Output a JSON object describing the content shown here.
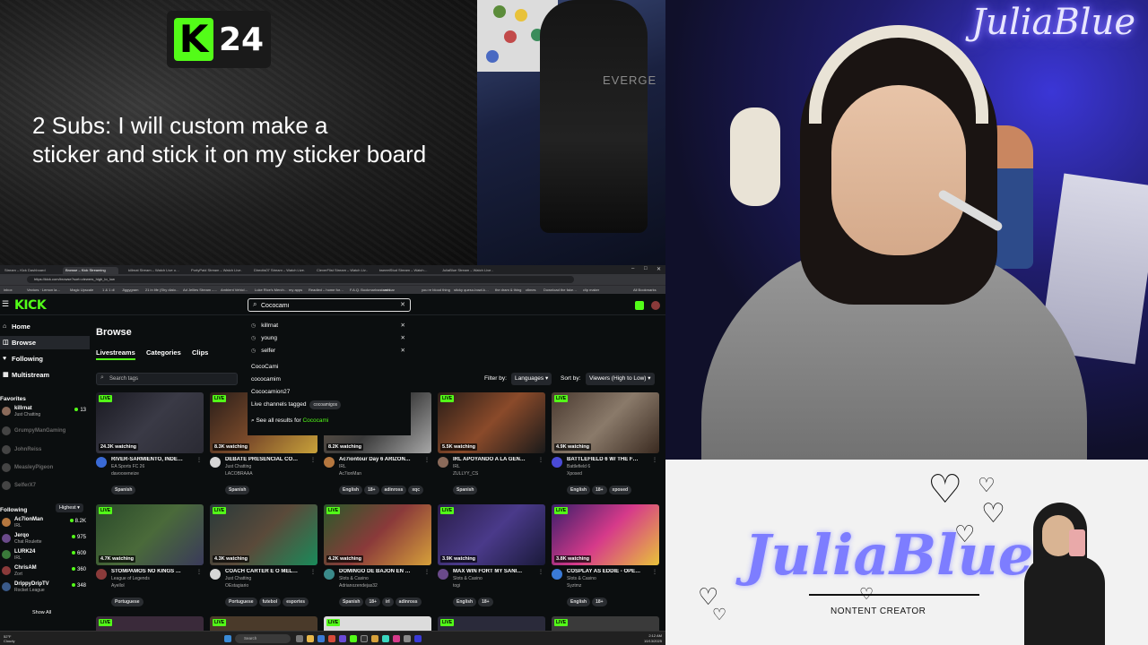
{
  "overlay": {
    "badge_k": "K",
    "badge_number": "24",
    "subs_text": "2 Subs: I will custom make a\nsticker and stick it on my sticker board"
  },
  "chair_cam": {
    "chair_brand": "EVERGE"
  },
  "webcam": {
    "title": "JuliaBlue"
  },
  "brand_panel": {
    "name": "JuliaBlue",
    "subtitle": "NONTENT CREATOR",
    "colors": {
      "accent": "#7d7dff",
      "background": "#f2f2f2"
    }
  },
  "browser": {
    "tabs": [
      "Stream – Kick Dashboard",
      "Browse – Kick Streaming",
      "killrnat Stream – Watch Live o…",
      "PortyPaid Stream – Watch Live…",
      "Directis07 Stream – Watch Live…",
      "CleverFlist Stream – Watch Liv…",
      "tweeetStud Stream – Watch…",
      "JuliaBlue Stream – Watch Live…"
    ],
    "window_controls": [
      "–",
      "□",
      "✕"
    ],
    "url": "https://kick.com/browse?sort=viewers_high_to_low",
    "bookmarks": [
      "inbox",
      "Vectors · Lemon la…",
      "Magic Upscale",
      "1 & 1 dl",
      "Jiggygram",
      "21 in life (Shy dialo…",
      "Ad Jellies Stream –…",
      "Ambient Vehicl…",
      "Luke Rice's Merch…",
      "my apps",
      "Readied – home for…",
      "F.A.Q. Bookmarks – area…",
      "reload bar",
      "you re blood thing",
      "sticky queso-bowl-k…",
      "the dram & thing",
      "ctimes",
      "Download the fake…",
      "clip maker",
      "All Bookmarks"
    ]
  },
  "kick": {
    "logo": "KICK",
    "search_value": "Cococami",
    "search_clear": "✕",
    "nav": [
      {
        "label": "Home",
        "icon": "⌂"
      },
      {
        "label": "Browse",
        "icon": "◫"
      },
      {
        "label": "Following",
        "icon": "♥"
      },
      {
        "label": "Multistream",
        "icon": "▦"
      }
    ],
    "favorites_title": "Favorites",
    "favorites": [
      {
        "name": "killrnat",
        "category": "Just Chatting",
        "viewers": "13",
        "online": true
      },
      {
        "name": "GrumpyManGaming",
        "online": false
      },
      {
        "name": "JohnReiss",
        "online": false
      },
      {
        "name": "MeasleyPigeon",
        "online": false
      },
      {
        "name": "SelferX7",
        "online": false
      }
    ],
    "following_title": "Following",
    "following_sort": "Highest ▾",
    "following": [
      {
        "name": "Ac7ionMan",
        "category": "IRL",
        "viewers": "8.2K"
      },
      {
        "name": "Jerqo",
        "category": "Chat Roulette",
        "viewers": "975"
      },
      {
        "name": "LURK24",
        "category": "IRL",
        "viewers": "609"
      },
      {
        "name": "ChrisAM",
        "category": "Zort",
        "viewers": "360"
      },
      {
        "name": "DrippyDripTV",
        "category": "Rocket League",
        "viewers": "348"
      }
    ],
    "show_all": "Show All",
    "browse_title": "Browse",
    "browse_tabs": [
      "Livestreams",
      "Categories",
      "Clips"
    ],
    "tag_search_placeholder": "Search tags",
    "filter_by_label": "Filter by:",
    "filter_value": "Languages ▾",
    "sort_by_label": "Sort by:",
    "sort_value": "Viewers (High to Low) ▾",
    "search_dropdown": {
      "history": [
        "killrnat",
        "young",
        "selfer"
      ],
      "suggestions": [
        "CocoCami",
        "cococamim",
        "Cococamion27"
      ],
      "live_tagged_label": "Live channels tagged",
      "live_tagged_tag": "cocoamigos",
      "see_all_prefix": "See all results for",
      "see_all_term": "Cococami"
    },
    "live_label": "LIVE",
    "cards": [
      {
        "watching": "24.3K watching",
        "title": "RIVER-SARMIENTO, INDE…",
        "category": "EA Sports FC 26",
        "channel": "davooxeneize",
        "tags": [
          "Spanish"
        ]
      },
      {
        "watching": "8.3K watching",
        "title": "DEBATE PRESENCIAL CO…",
        "category": "Just Chatting",
        "channel": "LACOBRAAA",
        "tags": [
          "Spanish"
        ]
      },
      {
        "watching": "8.2K watching",
        "title": "Ac7iontour Day 6 ARIZON…",
        "category": "IRL",
        "channel": "Ac7ionMan",
        "tags": [
          "English",
          "18+",
          "adinross",
          "xqc"
        ]
      },
      {
        "watching": "5.5K watching",
        "title": "IRL APOYANDO A LA GEN…",
        "category": "IRL",
        "channel": "ZULLYY_CS",
        "tags": [
          "Spanish"
        ]
      },
      {
        "watching": "4.9K watching",
        "title": "BATTLEFIELD 6 W/ THE F…",
        "category": "Battlefield 6",
        "channel": "Xposed",
        "tags": [
          "English",
          "18+",
          "xposed"
        ]
      },
      {
        "watching": "4.7K watching",
        "title": "STOMPAMOS NO KINGS …",
        "category": "League of Legends",
        "channel": "Ayellol",
        "tags": [
          "Portuguese"
        ]
      },
      {
        "watching": "4.3K watching",
        "title": "COACH CARTER E O MEL…",
        "category": "Just Chatting",
        "channel": "OEstagiario",
        "tags": [
          "Portuguese",
          "futebol",
          "esportes"
        ]
      },
      {
        "watching": "4.2K watching",
        "title": "DOMINGO DE BAJON EN …",
        "category": "Slots & Casino",
        "channel": "Adrianozendejas32",
        "tags": [
          "Spanish",
          "18+",
          "irl",
          "adinross"
        ]
      },
      {
        "watching": "3.9K watching",
        "title": "MAX WIN FORT MY SANI…",
        "category": "Slots & Casino",
        "channel": "togi",
        "tags": [
          "English",
          "18+"
        ]
      },
      {
        "watching": "3.8K watching",
        "title": "COSPLAY AS EDDIE - OPE…",
        "category": "Slots & Casino",
        "channel": "Syztmz",
        "tags": [
          "English",
          "18+"
        ]
      }
    ],
    "card_more": "⋮",
    "green": "#53fc18"
  },
  "taskbar": {
    "weather": "52°F\nCloudy",
    "search_placeholder": "Search",
    "time": "2:12 AM",
    "date": "10/13/2025"
  }
}
